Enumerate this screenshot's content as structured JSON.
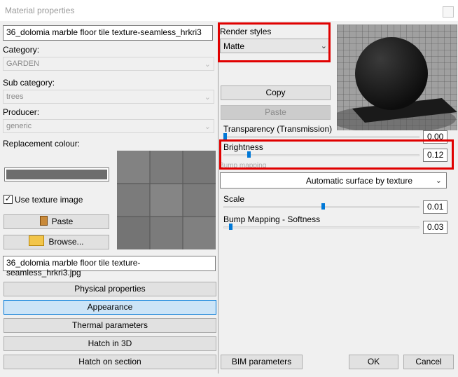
{
  "window": {
    "title": "Material properties"
  },
  "material_name": "36_dolomia marble floor tile texture-seamless_hrkri3",
  "category": {
    "label": "Category:",
    "value": "GARDEN"
  },
  "sub_category": {
    "label": "Sub category:",
    "value": "trees"
  },
  "producer": {
    "label": "Producer:",
    "value": "generic"
  },
  "replacement_colour": {
    "label": "Replacement colour:",
    "color": "#6d6d6d"
  },
  "use_texture": {
    "label": "Use texture image",
    "checked": true,
    "mark": "✓"
  },
  "texture_buttons": {
    "paste": "Paste",
    "browse": "Browse..."
  },
  "texture_file": "36_dolomia marble floor tile texture-seamless_hrkri3.jpg",
  "left_buttons": {
    "physical": "Physical properties",
    "appearance": "Appearance",
    "thermal": "Thermal parameters",
    "hatch3d": "Hatch in 3D",
    "hatch_section": "Hatch on section"
  },
  "render_styles": {
    "label": "Render styles",
    "value": "Matte"
  },
  "actions": {
    "copy": "Copy",
    "paste": "Paste"
  },
  "transparency": {
    "label": "Transparency (Transmission)",
    "value": "0.00",
    "level": 0.0
  },
  "brightness": {
    "label": "Brightness",
    "value": "0.12",
    "level": 0.12
  },
  "bump_hidden_label": "Bump mapping",
  "surface": {
    "value": "Automatic surface by texture"
  },
  "scale": {
    "label": "Scale",
    "value": "0.01",
    "level": 0.5
  },
  "bump_softness": {
    "label": "Bump Mapping - Softness",
    "value": "0.03",
    "level": 0.03
  },
  "bottom": {
    "bim": "BIM parameters",
    "ok": "OK",
    "cancel": "Cancel"
  },
  "colors": {
    "highlight": "#e00000",
    "accent": "#0078d7",
    "selected_bg": "#cce4f7"
  }
}
